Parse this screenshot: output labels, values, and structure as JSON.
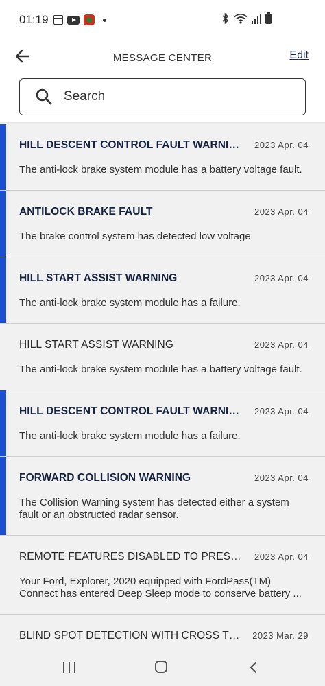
{
  "status_bar": {
    "time": "01:19",
    "left_icons": [
      "calendar-icon",
      "youtube-icon",
      "app-notification-icon",
      "more-notifications-dot"
    ],
    "right_icons": [
      "bluetooth-icon",
      "wifi-icon",
      "signal-icon",
      "battery-icon"
    ]
  },
  "header": {
    "title": "MESSAGE CENTER",
    "edit_label": "Edit"
  },
  "search": {
    "placeholder": "Search"
  },
  "colors": {
    "unread_accent": "#1c4fcf",
    "title_text": "#1c2b4a",
    "list_background": "#f1f1f2"
  },
  "messages": [
    {
      "title": "HILL DESCENT CONTROL FAULT WARNING",
      "date": "2023 Apr. 04",
      "body": "The anti-lock brake system module has a battery voltage fault.",
      "unread": true
    },
    {
      "title": "ANTILOCK BRAKE FAULT",
      "date": "2023 Apr. 04",
      "body": "The brake control system has detected  low voltage",
      "unread": true
    },
    {
      "title": "HILL START ASSIST WARNING",
      "date": "2023 Apr. 04",
      "body": "The anti-lock brake system module has a failure.",
      "unread": true
    },
    {
      "title": "HILL START ASSIST WARNING",
      "date": "2023 Apr. 04",
      "body": "The anti-lock brake system module has a battery voltage fault.",
      "unread": false
    },
    {
      "title": "HILL DESCENT CONTROL FAULT WARNING",
      "date": "2023 Apr. 04",
      "body": "The anti-lock brake system module has a failure.",
      "unread": true
    },
    {
      "title": "FORWARD COLLISION WARNING",
      "date": "2023 Apr. 04",
      "body": "The Collision Warning system has detected either a system fault or an obstructed radar sensor.",
      "unread": true
    },
    {
      "title": "REMOTE FEATURES DISABLED TO PRESERVE BA...",
      "date": "2023 Apr. 04",
      "body": "Your Ford, Explorer, 2020 equipped with FordPass(TM) Connect has entered Deep Sleep mode to conserve battery ...",
      "unread": false
    },
    {
      "title": "BLIND SPOT DETECTION WITH CROSS TRAFFIC",
      "date": "2023 Mar. 29",
      "body": "",
      "unread": false
    }
  ],
  "nav_bar": {
    "buttons": [
      "recent-apps-button",
      "home-button",
      "back-nav-button"
    ]
  }
}
